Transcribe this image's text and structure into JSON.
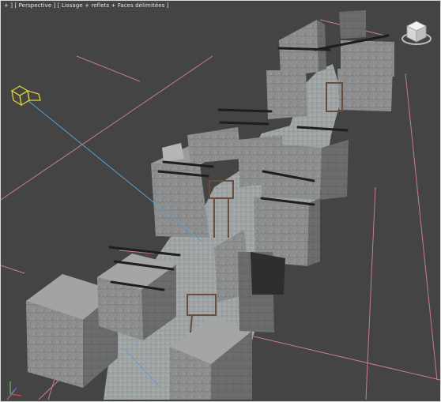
{
  "viewport": {
    "menu_plus": "+ ]",
    "view_name": "[ Perspective ]",
    "shading_mode": "[ Lissage + reflets + Faces délimitées ]"
  },
  "widgets": {
    "viewcube": "viewcube-icon",
    "camera": "camera-object-icon",
    "axis": "axis-tripod-icon"
  },
  "colors": {
    "background": "#444444",
    "grid_lines": "#c87c8c",
    "wall": "#8c8c8c",
    "wall_dark": "#5a5a5a",
    "ground": "#a8acad",
    "camera_target": "#5aa0d0",
    "camera_gizmo": "#d8d03c"
  }
}
